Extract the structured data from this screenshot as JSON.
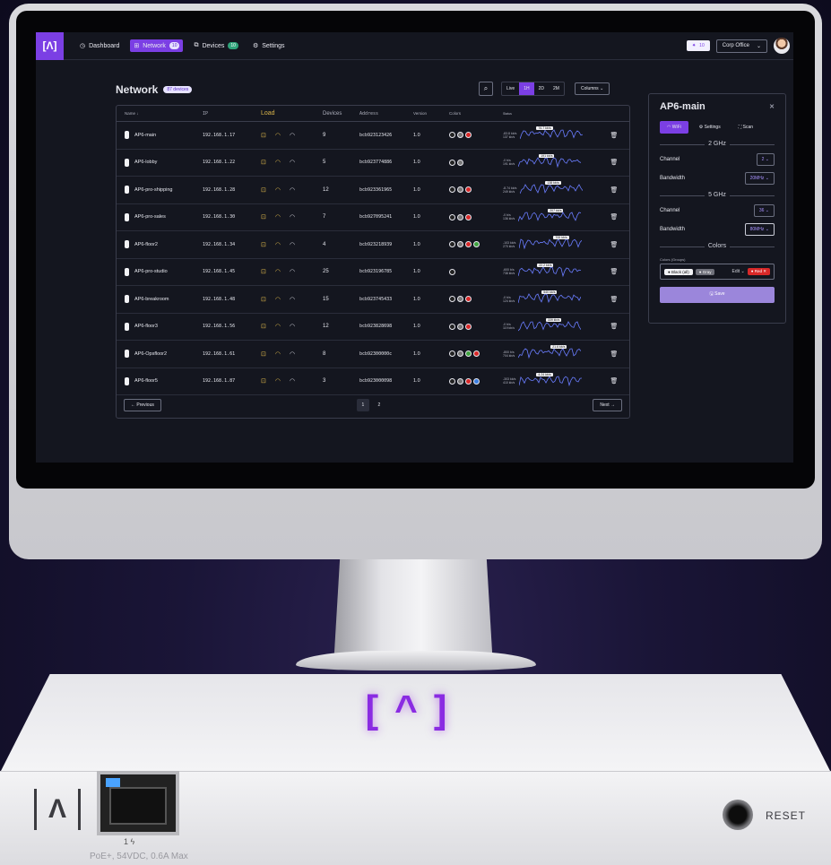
{
  "topbar": {
    "logo": "[Λ]",
    "nav": [
      {
        "label": "Dashboard",
        "icon": "clock-icon",
        "badge": ""
      },
      {
        "label": "Network",
        "icon": "network-icon",
        "badge": "10"
      },
      {
        "label": "Devices",
        "icon": "devices-icon",
        "badge": "10"
      }
    ],
    "settings_label": "Settings",
    "sun_badge": "10",
    "office": "Corp Office"
  },
  "network": {
    "title": "Network",
    "count": "87 devices",
    "ranges": [
      "Live",
      "1H",
      "2D",
      "2M"
    ],
    "active_range": "1H",
    "columns_label": "Columns"
  },
  "table": {
    "headers": {
      "name": "Name ↓",
      "ip": "IP",
      "load": "Load",
      "devices": "Devices",
      "address": "Address",
      "version": "Version",
      "colors": "Colors",
      "status": "Status"
    },
    "rows": [
      {
        "name": "AP6-main",
        "ip": "192.168.1.17",
        "devices": "9",
        "address": "bcb923123426",
        "version": "1.0",
        "colors": [
          "#222",
          "#777",
          "#d82828"
        ],
        "up": "-83.8 kb/s",
        "down": "137 kb/s",
        "tag": "76.7 kb/s"
      },
      {
        "name": "AP6-lobby",
        "ip": "192.168.1.22",
        "devices": "5",
        "address": "bcb923774886",
        "version": "1.0",
        "colors": [
          "#222",
          "#777"
        ],
        "up": "-0 b/s",
        "down": "191 kb/s",
        "tag": "191 kb/s"
      },
      {
        "name": "AP6-pro-shipping",
        "ip": "192.168.1.28",
        "devices": "12",
        "address": "bcb923361965",
        "version": "1.0",
        "colors": [
          "#222",
          "#777",
          "#d82828"
        ],
        "up": "-8.74 kb/s",
        "down": "249 kb/s",
        "tag": "138 kb/s"
      },
      {
        "name": "AP6-pro-sales",
        "ip": "192.168.1.30",
        "devices": "7",
        "address": "bcb927095241",
        "version": "1.0",
        "colors": [
          "#222",
          "#777",
          "#d82828"
        ],
        "up": "-0 b/s",
        "down": "136 kb/s",
        "tag": "207 kb/s"
      },
      {
        "name": "AP6-floor2",
        "ip": "192.168.1.34",
        "devices": "4",
        "address": "bcb923218939",
        "version": "1.0",
        "colors": [
          "#222",
          "#777",
          "#d82828",
          "#3fa33f"
        ],
        "up": "-103 kb/s",
        "down": "270 kb/s",
        "tag": "700 kb/s"
      },
      {
        "name": "AP6-pro-studio",
        "ip": "192.168.1.45",
        "devices": "25",
        "address": "bcb923196785",
        "version": "1.0",
        "colors": [
          "#222"
        ],
        "up": "-600 b/s",
        "down": "738 kb/s",
        "tag": "22.2 kb/s"
      },
      {
        "name": "AP6-breakroom",
        "ip": "192.168.1.48",
        "devices": "15",
        "address": "bcb923745433",
        "version": "1.0",
        "colors": [
          "#222",
          "#777",
          "#d82828"
        ],
        "up": "-0 b/s",
        "down": "124 kb/s",
        "tag": "540 kb/s"
      },
      {
        "name": "AP6-floor3",
        "ip": "192.168.1.56",
        "devices": "12",
        "address": "bcb923828698",
        "version": "1.0",
        "colors": [
          "#222",
          "#777",
          "#d82828"
        ],
        "up": "-0 b/s",
        "down": "119 kb/s",
        "tag": "339 kb/s"
      },
      {
        "name": "AP6-Opsfloor2",
        "ip": "192.168.1.61",
        "devices": "8",
        "address": "bcb92300000c",
        "version": "1.0",
        "colors": [
          "#222",
          "#777",
          "#3fa33f",
          "#d82828"
        ],
        "up": "-800 b/s",
        "down": "704 kb/s",
        "tag": "21.6 kb/s"
      },
      {
        "name": "AP6-floor5",
        "ip": "192.168.1.87",
        "devices": "3",
        "address": "bcb923000098",
        "version": "1.0",
        "colors": [
          "#222",
          "#777",
          "#d82828",
          "#3b7de0"
        ],
        "up": "-303 kb/s",
        "down": "410 kb/s",
        "tag": "4.24 kb/s"
      }
    ],
    "previous_label": "Previous",
    "next_label": "Next",
    "pages": [
      "1",
      "2"
    ]
  },
  "panel": {
    "title": "AP6-main",
    "tabs": [
      "WiFi",
      "Settings",
      "Scan"
    ],
    "section_2ghz": "2 GHz",
    "channel_label": "Channel",
    "channel_2": "2",
    "bandwidth_label": "Bandwidth",
    "bandwidth_2": "20MHz",
    "section_5ghz": "5 GHz",
    "channel_5": "36",
    "bandwidth_5": "80MHz",
    "section_colors": "Colors",
    "colors_groups_label": "Colors (Groups)",
    "chips": [
      "Black (all)",
      "Gray",
      "Red"
    ],
    "edit_label": "Edit",
    "save_label": "Save"
  },
  "hardware": {
    "port_label": "1 ϟ",
    "poe_label": "PoE+, 54VDC, 0.6A Max",
    "reset_label": "RESET"
  },
  "colors": {
    "accent": "#7b3fe4",
    "screen_bg": "#14161f"
  }
}
